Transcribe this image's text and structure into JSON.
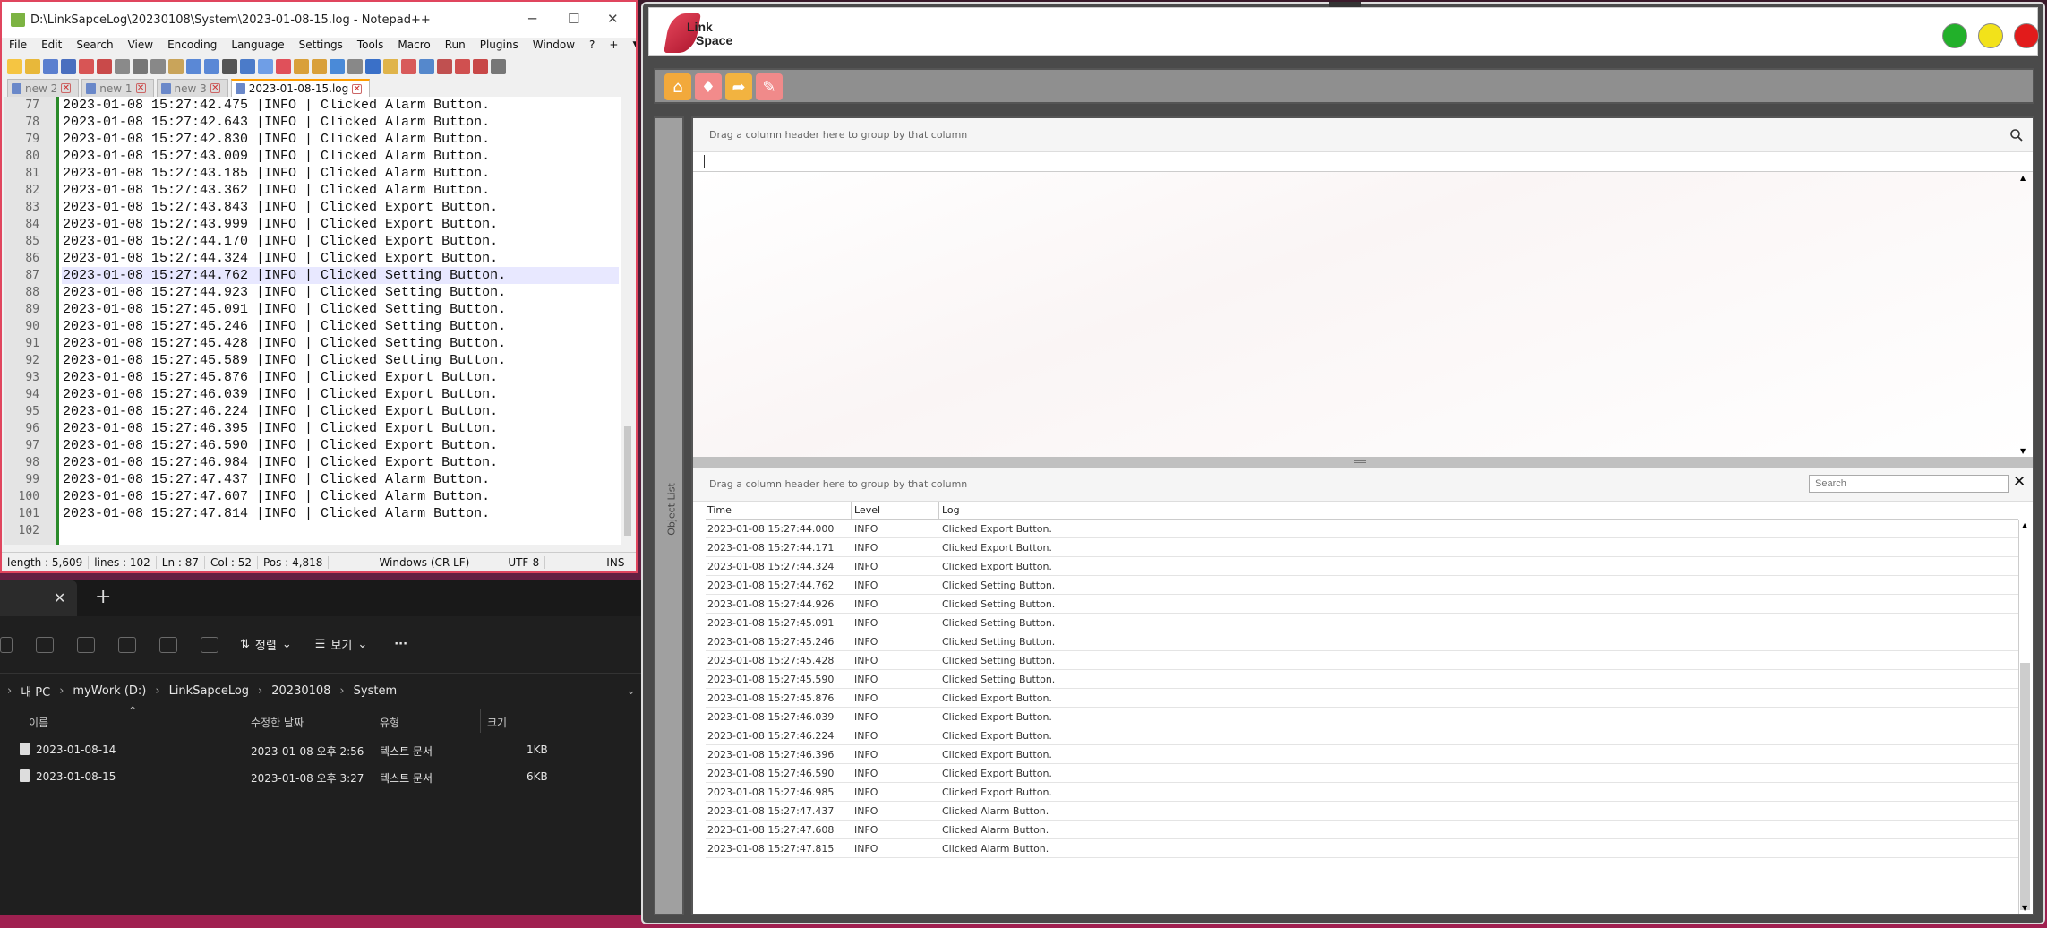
{
  "notepad": {
    "title": "D:\\LinkSapceLog\\20230108\\System\\2023-01-08-15.log - Notepad++",
    "window_controls": [
      "─",
      "☐",
      "✕"
    ],
    "menu": [
      "File",
      "Edit",
      "Search",
      "View",
      "Encoding",
      "Language",
      "Settings",
      "Tools",
      "Macro",
      "Run",
      "Plugins",
      "Window",
      "?"
    ],
    "menu_right": [
      "+",
      "▼",
      "✕"
    ],
    "tabs": [
      {
        "label": "new 2"
      },
      {
        "label": "new 1"
      },
      {
        "label": "new 3"
      },
      {
        "label": "2023-01-08-15.log",
        "active": true
      }
    ],
    "current_line": "87",
    "lines": [
      {
        "num": "77",
        "text": "2023-01-08 15:27:42.475 |INFO | Clicked Alarm Button."
      },
      {
        "num": "78",
        "text": "2023-01-08 15:27:42.643 |INFO | Clicked Alarm Button."
      },
      {
        "num": "79",
        "text": "2023-01-08 15:27:42.830 |INFO | Clicked Alarm Button."
      },
      {
        "num": "80",
        "text": "2023-01-08 15:27:43.009 |INFO | Clicked Alarm Button."
      },
      {
        "num": "81",
        "text": "2023-01-08 15:27:43.185 |INFO | Clicked Alarm Button."
      },
      {
        "num": "82",
        "text": "2023-01-08 15:27:43.362 |INFO | Clicked Alarm Button."
      },
      {
        "num": "83",
        "text": "2023-01-08 15:27:43.843 |INFO | Clicked Export Button."
      },
      {
        "num": "84",
        "text": "2023-01-08 15:27:43.999 |INFO | Clicked Export Button."
      },
      {
        "num": "85",
        "text": "2023-01-08 15:27:44.170 |INFO | Clicked Export Button."
      },
      {
        "num": "86",
        "text": "2023-01-08 15:27:44.324 |INFO | Clicked Export Button."
      },
      {
        "num": "87",
        "text": "2023-01-08 15:27:44.762 |INFO | Clicked Setting Button."
      },
      {
        "num": "88",
        "text": "2023-01-08 15:27:44.923 |INFO | Clicked Setting Button."
      },
      {
        "num": "89",
        "text": "2023-01-08 15:27:45.091 |INFO | Clicked Setting Button."
      },
      {
        "num": "90",
        "text": "2023-01-08 15:27:45.246 |INFO | Clicked Setting Button."
      },
      {
        "num": "91",
        "text": "2023-01-08 15:27:45.428 |INFO | Clicked Setting Button."
      },
      {
        "num": "92",
        "text": "2023-01-08 15:27:45.589 |INFO | Clicked Setting Button."
      },
      {
        "num": "93",
        "text": "2023-01-08 15:27:45.876 |INFO | Clicked Export Button."
      },
      {
        "num": "94",
        "text": "2023-01-08 15:27:46.039 |INFO | Clicked Export Button."
      },
      {
        "num": "95",
        "text": "2023-01-08 15:27:46.224 |INFO | Clicked Export Button."
      },
      {
        "num": "96",
        "text": "2023-01-08 15:27:46.395 |INFO | Clicked Export Button."
      },
      {
        "num": "97",
        "text": "2023-01-08 15:27:46.590 |INFO | Clicked Export Button."
      },
      {
        "num": "98",
        "text": "2023-01-08 15:27:46.984 |INFO | Clicked Export Button."
      },
      {
        "num": "99",
        "text": "2023-01-08 15:27:47.437 |INFO | Clicked Alarm Button."
      },
      {
        "num": "100",
        "text": "2023-01-08 15:27:47.607 |INFO | Clicked Alarm Button."
      },
      {
        "num": "101",
        "text": "2023-01-08 15:27:47.814 |INFO | Clicked Alarm Button."
      },
      {
        "num": "102",
        "text": ""
      }
    ],
    "status": {
      "length": "length : 5,609",
      "lines": "lines : 102",
      "ln": "Ln : 87",
      "col": "Col : 52",
      "pos": "Pos : 4,818",
      "eol": "Windows (CR LF)",
      "encoding": "UTF-8",
      "mode": "INS"
    }
  },
  "explorer": {
    "close_tab": "✕",
    "new_tab": "+",
    "toolbar": {
      "sort": "정렬",
      "view": "보기",
      "more": "···"
    },
    "breadcrumb": [
      "내 PC",
      "myWork (D:)",
      "LinkSapceLog",
      "20230108",
      "System"
    ],
    "columns": [
      "이름",
      "수정한 날짜",
      "유형",
      "크기"
    ],
    "files": [
      {
        "name": "2023-01-08-14",
        "modified": "2023-01-08 오후 2:56",
        "type": "텍스트 문서",
        "size": "1KB"
      },
      {
        "name": "2023-01-08-15",
        "modified": "2023-01-08 오후 3:27",
        "type": "텍스트 문서",
        "size": "6KB"
      }
    ]
  },
  "linkspace": {
    "logo_line1": "Link",
    "logo_line2": "Space",
    "window_buttons": [
      {
        "color": "#22b02a"
      },
      {
        "color": "#f2e21a"
      },
      {
        "color": "#e21b1b"
      }
    ],
    "toolbar_buttons": [
      {
        "icon": "home-icon",
        "glyph": "⌂",
        "color": "#f2a93b"
      },
      {
        "icon": "alarm-icon",
        "glyph": "♦",
        "color": "#f28b8b"
      },
      {
        "icon": "export-icon",
        "glyph": "➦",
        "color": "#f2b340"
      },
      {
        "icon": "setting-icon",
        "glyph": "✎",
        "color": "#f08a8a"
      }
    ],
    "side_label": "Object List",
    "grid1": {
      "group_hint": "Drag a column header here to group by that column"
    },
    "grid2": {
      "group_hint": "Drag a column header here to group by that column",
      "search_placeholder": "Search",
      "columns": [
        "Time",
        "Level",
        "Log"
      ],
      "rows": [
        {
          "time": "2023-01-08 15:27:44.000",
          "level": "INFO",
          "log": "Clicked Export Button."
        },
        {
          "time": "2023-01-08 15:27:44.171",
          "level": "INFO",
          "log": "Clicked Export Button."
        },
        {
          "time": "2023-01-08 15:27:44.324",
          "level": "INFO",
          "log": "Clicked Export Button."
        },
        {
          "time": "2023-01-08 15:27:44.762",
          "level": "INFO",
          "log": "Clicked Setting Button."
        },
        {
          "time": "2023-01-08 15:27:44.926",
          "level": "INFO",
          "log": "Clicked Setting Button."
        },
        {
          "time": "2023-01-08 15:27:45.091",
          "level": "INFO",
          "log": "Clicked Setting Button."
        },
        {
          "time": "2023-01-08 15:27:45.246",
          "level": "INFO",
          "log": "Clicked Setting Button."
        },
        {
          "time": "2023-01-08 15:27:45.428",
          "level": "INFO",
          "log": "Clicked Setting Button."
        },
        {
          "time": "2023-01-08 15:27:45.590",
          "level": "INFO",
          "log": "Clicked Setting Button."
        },
        {
          "time": "2023-01-08 15:27:45.876",
          "level": "INFO",
          "log": "Clicked Export Button."
        },
        {
          "time": "2023-01-08 15:27:46.039",
          "level": "INFO",
          "log": "Clicked Export Button."
        },
        {
          "time": "2023-01-08 15:27:46.224",
          "level": "INFO",
          "log": "Clicked Export Button."
        },
        {
          "time": "2023-01-08 15:27:46.396",
          "level": "INFO",
          "log": "Clicked Export Button."
        },
        {
          "time": "2023-01-08 15:27:46.590",
          "level": "INFO",
          "log": "Clicked Export Button."
        },
        {
          "time": "2023-01-08 15:27:46.985",
          "level": "INFO",
          "log": "Clicked Export Button."
        },
        {
          "time": "2023-01-08 15:27:47.437",
          "level": "INFO",
          "log": "Clicked Alarm Button."
        },
        {
          "time": "2023-01-08 15:27:47.608",
          "level": "INFO",
          "log": "Clicked Alarm Button."
        },
        {
          "time": "2023-01-08 15:27:47.815",
          "level": "INFO",
          "log": "Clicked Alarm Button."
        }
      ]
    }
  }
}
